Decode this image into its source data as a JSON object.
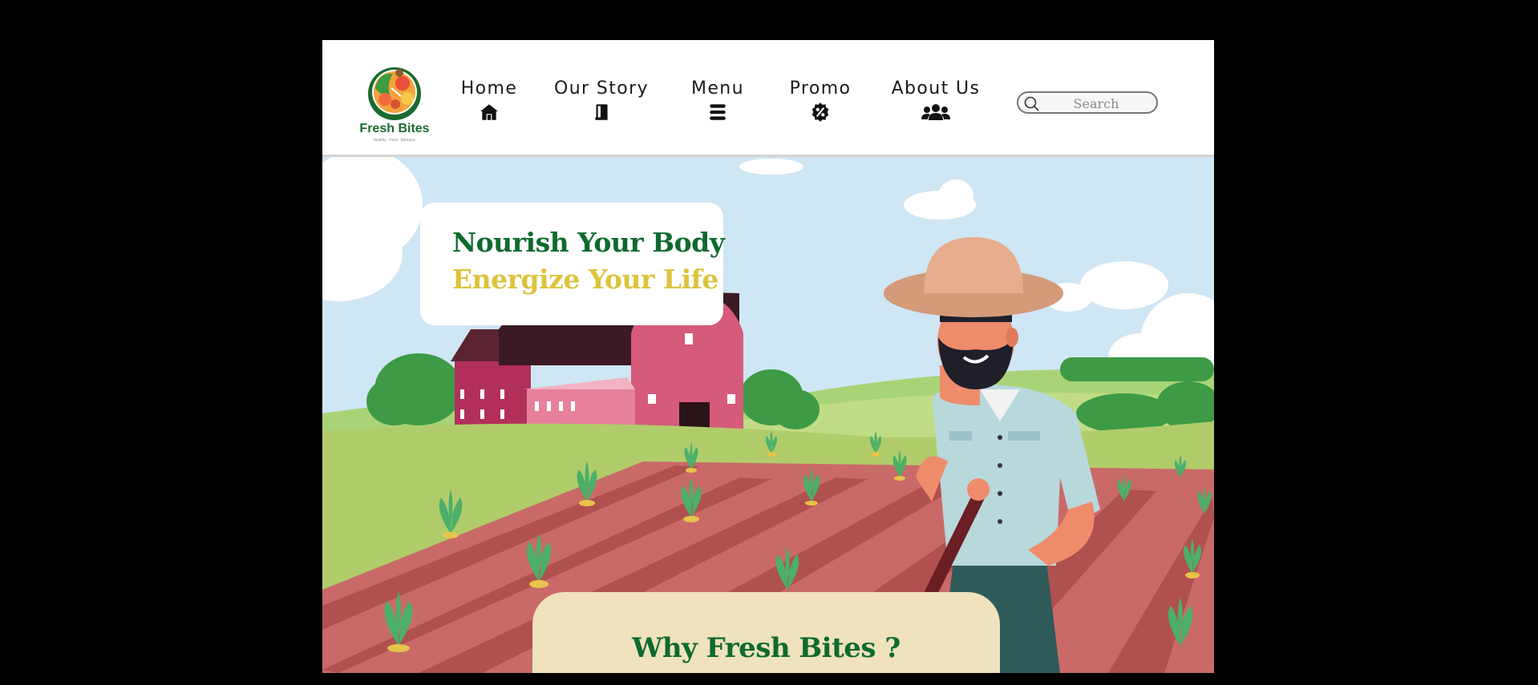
{
  "brand": {
    "name": "Fresh Bites",
    "tagline": "Healthy · Fresh · Delicious",
    "colors": {
      "green": "#0e6a2f",
      "yellow": "#ddc33c",
      "cream": "#efe2bd"
    }
  },
  "nav": {
    "items": [
      {
        "label": "Home",
        "icon": "home-icon"
      },
      {
        "label": "Our Story",
        "icon": "book-icon"
      },
      {
        "label": "Menu",
        "icon": "menu-bars-icon"
      },
      {
        "label": "Promo",
        "icon": "percent-badge-icon"
      },
      {
        "label": "About Us",
        "icon": "users-icon"
      }
    ]
  },
  "search": {
    "placeholder": "Search",
    "icon": "search-icon"
  },
  "hero": {
    "headline_1": "Nourish Your Body",
    "headline_2": "Energize Your Life",
    "illustration": "farmer-field-illustration"
  },
  "why": {
    "title": "Why Fresh Bites ?"
  }
}
